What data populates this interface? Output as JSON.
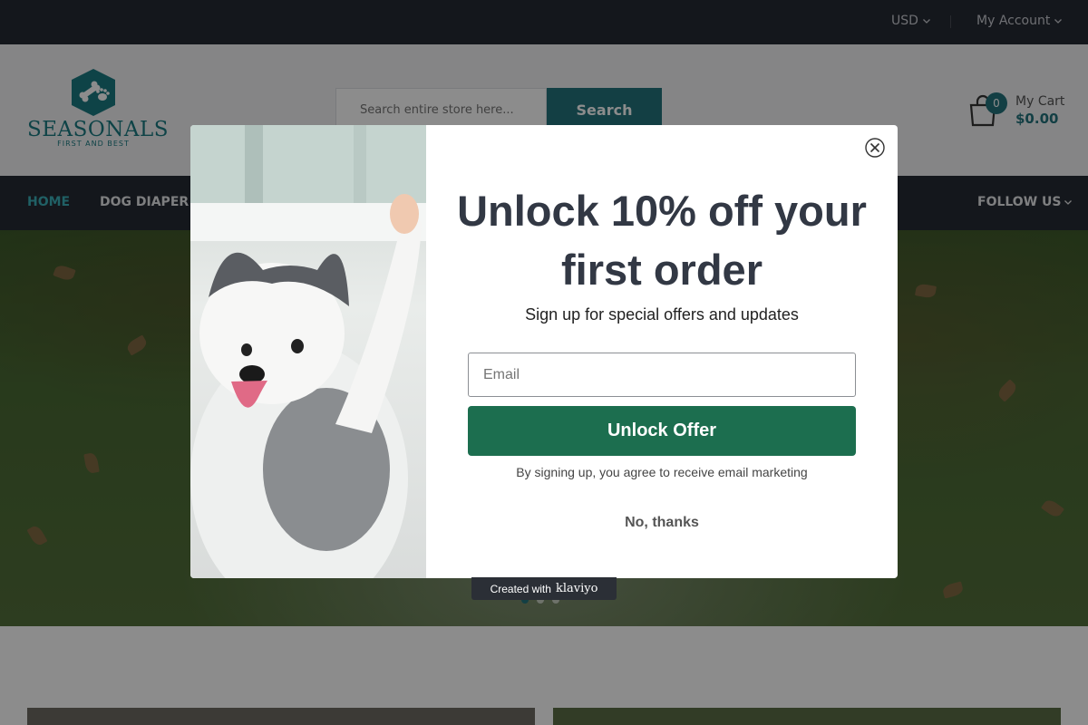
{
  "topbar": {
    "currency": "USD",
    "account": "My Account"
  },
  "header": {
    "logo_text": "SEASONALS",
    "logo_tagline": "FIRST AND BEST",
    "search_placeholder": "Search entire store here...",
    "search_button": "Search",
    "cart_count": "0",
    "cart_label": "My Cart",
    "cart_amount": "$0.00"
  },
  "nav": {
    "items": [
      {
        "label": "HOME"
      },
      {
        "label": "DOG DIAPER SE"
      }
    ],
    "follow": "FOLLOW US"
  },
  "hero": {
    "active_slide": 1,
    "slide_count": 3
  },
  "modal": {
    "headline": "Unlock 10% off your first order",
    "subheadline": "Sign up for special offers and updates",
    "email_placeholder": "Email",
    "submit_label": "Unlock Offer",
    "disclaimer": "By signing up, you agree to receive email marketing",
    "dismiss_label": "No, thanks"
  },
  "badge": {
    "prefix": "Created with",
    "brand": "klaviyo"
  },
  "colors": {
    "brand_teal": "#23737d",
    "cta_green": "#1c6e4f",
    "dark_bar": "#262a33"
  }
}
